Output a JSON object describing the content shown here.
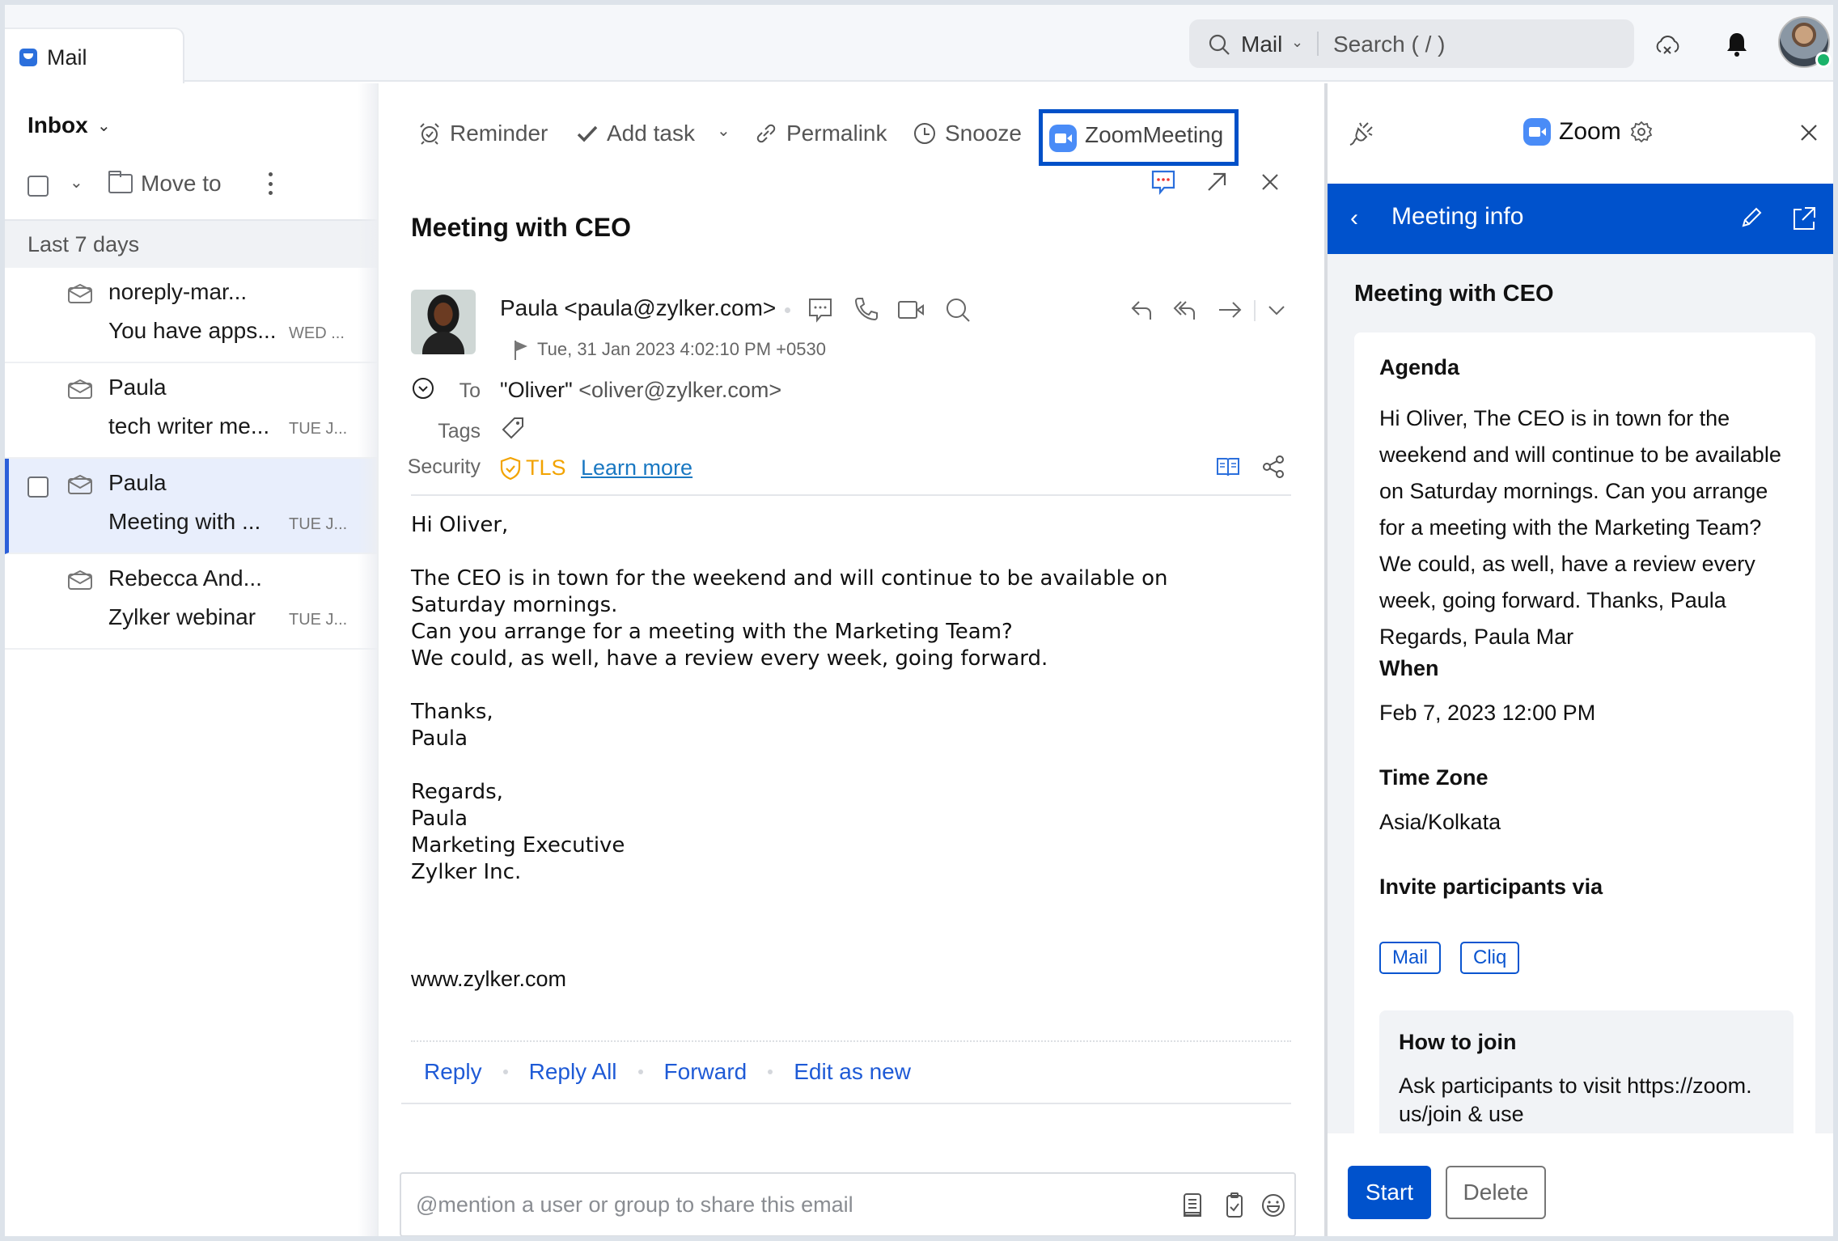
{
  "app": {
    "tab_label": "Mail",
    "brand_color": "#0052cc"
  },
  "topbar": {
    "search_scope": "Mail",
    "search_placeholder": "Search ( / )"
  },
  "list": {
    "folder": "Inbox",
    "move_to_label": "Move to",
    "group_label": "Last 7 days",
    "items": [
      {
        "sender": "noreply-mar...",
        "subject": "You have apps...",
        "date": "WED ...",
        "selected": false
      },
      {
        "sender": "Paula",
        "subject": "tech writer me...",
        "date": "TUE J...",
        "selected": false
      },
      {
        "sender": "Paula",
        "subject": "Meeting with ...",
        "date": "TUE J...",
        "selected": true
      },
      {
        "sender": "Rebecca And...",
        "subject": "Zylker webinar",
        "date": "TUE J...",
        "selected": false
      }
    ]
  },
  "reading": {
    "toolbar": {
      "reminder": "Reminder",
      "add_task": "Add task",
      "permalink": "Permalink",
      "snooze": "Snooze",
      "zoom_meeting": "ZoomMeeting"
    },
    "subject": "Meeting with CEO",
    "from": "Paula <paula@zylker.com>",
    "date": "Tue, 31 Jan 2023 4:02:10 PM +0530",
    "to_label": "To",
    "to_name": "\"Oliver\"",
    "to_address": "<oliver@zylker.com>",
    "tags_label": "Tags",
    "security_label": "Security",
    "security_value": "TLS",
    "learn_more": "Learn more",
    "body": "Hi Oliver,\n\nThe CEO is in town for the weekend and will continue to be available on\nSaturday mornings.\nCan you arrange for a meeting with the Marketing Team?\nWe could, as well, have a review every week, going forward.\n\nThanks,\nPaula\n\nRegards,\nPaula\nMarketing Executive\nZylker Inc.",
    "website": "www.zylker.com",
    "actions": {
      "reply": "Reply",
      "reply_all": "Reply All",
      "forward": "Forward",
      "edit_as_new": "Edit as new"
    },
    "comment_placeholder": "@mention a user or group to share this email"
  },
  "zoom_panel": {
    "app_name": "Zoom",
    "header_title": "Meeting info",
    "meeting_title": "Meeting with CEO",
    "agenda_label": "Agenda",
    "agenda_text": "Hi Oliver, The CEO is in town for the weekend and will continue to be available on Saturday mornings. Can you arrange for a meeting with the Marketing Team? We could, as well, have a review every week, going forward. Thanks, Paula Regards, Paula Mar",
    "when_label": "When",
    "when_value": "Feb 7, 2023 12:00 PM",
    "timezone_label": "Time Zone",
    "timezone_value": "Asia/Kolkata",
    "invite_label": "Invite participants via",
    "invite_mail": "Mail",
    "invite_cliq": "Cliq",
    "howto_label": "How to join",
    "howto_text": "Ask participants to visit https://zoom. us/join & use",
    "start_label": "Start",
    "delete_label": "Delete"
  }
}
